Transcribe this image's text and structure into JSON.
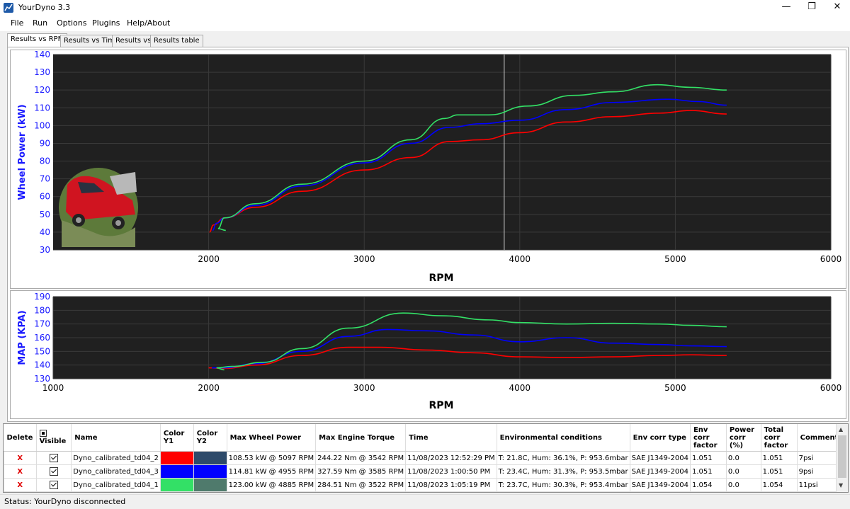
{
  "window": {
    "title": "YourDyno 3.3"
  },
  "menu": [
    "File",
    "Run",
    "Options",
    "Plugins",
    "Help/About"
  ],
  "tabs": [
    "Results vs RPM",
    "Results vs Time",
    "Results vs",
    "Results table"
  ],
  "colors": {
    "red": "#ff0000",
    "blue": "#0000ff",
    "green": "#33e066",
    "plot_bg": "#202020",
    "y_axis_text": "#1a1aff"
  },
  "chart_data": [
    {
      "type": "line",
      "ylabel": "Wheel Power (kW)",
      "xlabel": "RPM",
      "xlim": [
        1000,
        6000
      ],
      "ylim": [
        30,
        140
      ],
      "xticks": [
        2000,
        3000,
        4000,
        5000,
        6000
      ],
      "yticks": [
        30,
        40,
        50,
        60,
        70,
        80,
        90,
        100,
        110,
        120,
        130,
        140
      ],
      "cursor_x": 3900,
      "grid": true,
      "series": [
        {
          "color": "#ff0000",
          "x": [
            2005,
            2030,
            2100,
            2300,
            2600,
            3000,
            3300,
            3550,
            3750,
            4000,
            4300,
            4600,
            4900,
            5100,
            5330
          ],
          "y": [
            40,
            44,
            48,
            54,
            63,
            75,
            82,
            91,
            92,
            96,
            102,
            105,
            107,
            108.5,
            106.5
          ]
        },
        {
          "color": "#0000ff",
          "x": [
            2025,
            2050,
            2100,
            2300,
            2600,
            3000,
            3300,
            3550,
            3750,
            4000,
            4300,
            4600,
            4955,
            5150,
            5330
          ],
          "y": [
            41,
            45,
            48,
            55,
            66,
            79,
            90,
            99,
            101,
            103,
            109,
            113,
            114.8,
            113.5,
            111.5
          ]
        },
        {
          "color": "#33e066",
          "x": [
            2110,
            2060,
            2100,
            2300,
            2600,
            3000,
            3300,
            3520,
            3600,
            3800,
            4050,
            4350,
            4600,
            4885,
            5100,
            5330
          ],
          "y": [
            41,
            42,
            48,
            56,
            67,
            80,
            92,
            104,
            106,
            106,
            111,
            117,
            119,
            123,
            121.5,
            120
          ]
        }
      ]
    },
    {
      "type": "line",
      "ylabel": "MAP (KPA)",
      "xlabel": "RPM",
      "xlim": [
        1000,
        6000
      ],
      "ylim": [
        130,
        190
      ],
      "xticks": [
        1000,
        2000,
        3000,
        4000,
        5000,
        6000
      ],
      "yticks": [
        130,
        140,
        150,
        160,
        170,
        180,
        190
      ],
      "grid": true,
      "series": [
        {
          "color": "#ff0000",
          "x": [
            2000,
            2100,
            2300,
            2600,
            2900,
            3100,
            3400,
            3700,
            4000,
            4300,
            4600,
            4900,
            5100,
            5330
          ],
          "y": [
            138,
            137.5,
            140,
            147,
            153,
            153,
            151,
            149,
            146,
            145.5,
            146,
            147,
            147.5,
            147
          ]
        },
        {
          "color": "#0000ff",
          "x": [
            2020,
            2100,
            2300,
            2600,
            2900,
            3150,
            3400,
            3700,
            4000,
            4300,
            4600,
            4900,
            5100,
            5330
          ],
          "y": [
            138,
            138,
            141,
            150,
            161,
            166,
            165,
            162,
            157,
            160,
            156,
            155,
            154,
            153.5
          ]
        },
        {
          "color": "#33e066",
          "x": [
            2100,
            2050,
            2150,
            2350,
            2600,
            2900,
            3250,
            3500,
            3800,
            4000,
            4300,
            4600,
            4900,
            5100,
            5330
          ],
          "y": [
            136.5,
            138,
            139,
            142,
            152,
            167,
            178,
            176,
            173,
            171,
            170,
            170.5,
            170,
            169,
            168
          ]
        }
      ]
    }
  ],
  "table": {
    "headers": [
      "Delete",
      "Visible",
      "Name",
      "Color Y1",
      "Color Y2",
      "Max Wheel Power",
      "Max Engine Torque",
      "Time",
      "Environmental conditions",
      "Env corr type",
      "Env corr factor",
      "Power corr (%)",
      "Total corr factor",
      "Comments"
    ],
    "rows": [
      {
        "delete": "X",
        "name": "Dyno_calibrated_td04_2",
        "color_y1": "#ff0000",
        "color_y2": "#2e4a6a",
        "max_wheel_power": "108.53 kW @ 5097 RPM",
        "max_engine_torque": "244.22 Nm @ 3542 RPM",
        "time": "11/08/2023 12:52:29 PM",
        "env": "T: 21.8C, Hum: 36.1%, P: 953.6mbar",
        "env_corr_type": "SAE J1349-2004",
        "env_corr_factor": "1.051",
        "power_corr": "0.0",
        "total_corr_factor": "1.051",
        "comments": "7psi"
      },
      {
        "delete": "X",
        "name": "Dyno_calibrated_td04_3",
        "color_y1": "#0000ff",
        "color_y2": "#0000ff",
        "max_wheel_power": "114.81 kW @ 4955 RPM",
        "max_engine_torque": "327.59 Nm @ 3585 RPM",
        "time": "11/08/2023 1:00:50 PM",
        "env": "T: 23.4C, Hum: 31.3%, P: 953.5mbar",
        "env_corr_type": "SAE J1349-2004",
        "env_corr_factor": "1.051",
        "power_corr": "0.0",
        "total_corr_factor": "1.051",
        "comments": "9psi"
      },
      {
        "delete": "X",
        "name": "Dyno_calibrated_td04_1",
        "color_y1": "#33e066",
        "color_y2": "#4f7a6c",
        "max_wheel_power": "123.00 kW @ 4885 RPM",
        "max_engine_torque": "284.51 Nm @ 3522 RPM",
        "time": "11/08/2023 1:05:19 PM",
        "env": "T: 23.7C, Hum: 30.3%, P: 953.4mbar",
        "env_corr_type": "SAE J1349-2004",
        "env_corr_factor": "1.054",
        "power_corr": "0.0",
        "total_corr_factor": "1.054",
        "comments": "11psi"
      }
    ]
  },
  "status": "Status: YourDyno disconnected"
}
